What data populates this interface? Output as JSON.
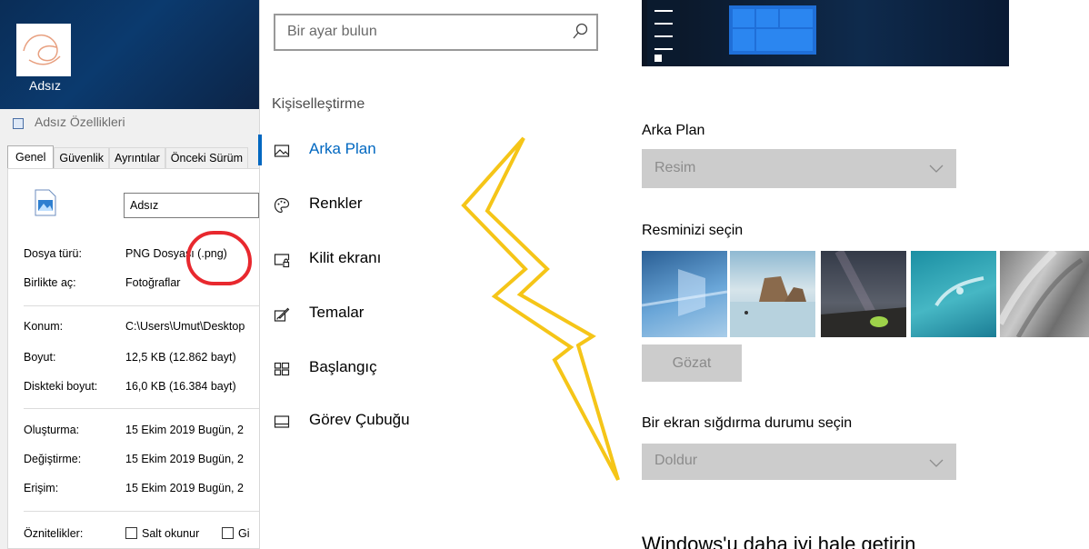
{
  "desktop": {
    "icon_label": "Adsız"
  },
  "properties": {
    "title": "Adsız Özellikleri",
    "tabs": [
      "Genel",
      "Güvenlik",
      "Ayrıntılar",
      "Önceki Sürüm"
    ],
    "file_name": "Adsız",
    "rows": [
      {
        "label": "Dosya türü:",
        "value": "PNG Dosyası (.png)"
      },
      {
        "label": "Birlikte aç:",
        "value": "Fotoğraflar"
      },
      {
        "label": "Konum:",
        "value": "C:\\Users\\Umut\\Desktop"
      },
      {
        "label": "Boyut:",
        "value": "12,5 KB (12.862 bayt)"
      },
      {
        "label": "Diskteki boyut:",
        "value": "16,0 KB (16.384 bayt)"
      },
      {
        "label": "Oluşturma:",
        "value": "15 Ekim 2019 Bugün, 2"
      },
      {
        "label": "Değiştirme:",
        "value": "15 Ekim 2019 Bugün, 2"
      },
      {
        "label": "Erişim:",
        "value": "15 Ekim 2019 Bugün, 2"
      }
    ],
    "attributes_label": "Öznitelikler:",
    "readonly_label": "Salt okunur",
    "hidden_label": "Gi"
  },
  "settings": {
    "search_placeholder": "Bir ayar bulun",
    "section": "Kişiselleştirme",
    "nav": [
      {
        "label": "Arka Plan",
        "icon": "picture-icon"
      },
      {
        "label": "Renkler",
        "icon": "palette-icon"
      },
      {
        "label": "Kilit ekranı",
        "icon": "lock-screen-icon"
      },
      {
        "label": "Temalar",
        "icon": "brush-icon"
      },
      {
        "label": "Başlangıç",
        "icon": "start-icon"
      },
      {
        "label": "Görev Çubuğu",
        "icon": "taskbar-icon"
      }
    ],
    "background_label": "Arka Plan",
    "background_value": "Resim",
    "choose_label": "Resminizi seçin",
    "browse_label": "Gözat",
    "fit_label": "Bir ekran sığdırma durumu seçin",
    "fit_value": "Doldur",
    "better_title": "Windows'u daha iyi hale getirin"
  },
  "colors": {
    "accent": "#0067c0",
    "annotation_red": "#e8282e",
    "bolt_yellow": "#f5c518"
  }
}
